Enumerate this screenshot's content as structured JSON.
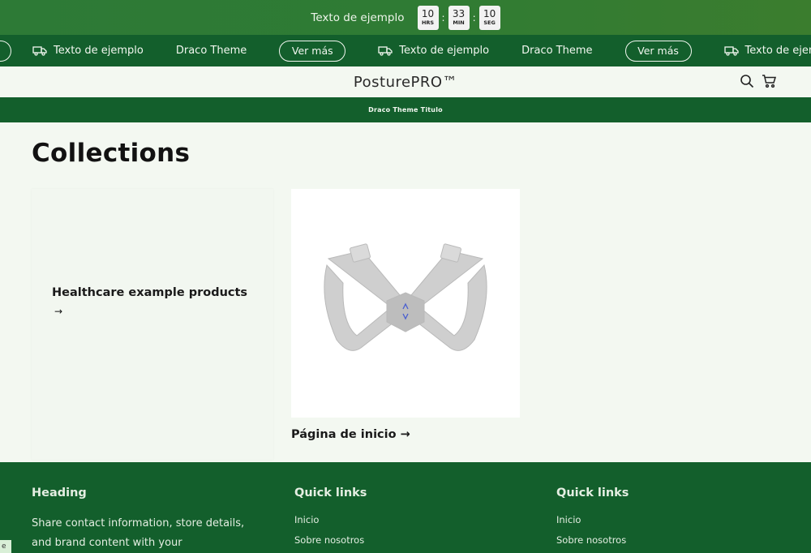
{
  "topbar": {
    "promo_text": "Texto de ejemplo",
    "countdown": [
      {
        "value": "10",
        "unit": "HRS"
      },
      {
        "value": "33",
        "unit": "MIN"
      },
      {
        "value": "10",
        "unit": "SEG"
      }
    ],
    "separator": ":"
  },
  "marquee": {
    "item_text": "Texto de ejemplo",
    "brand_text": "Draco Theme",
    "button_label": "Ver más"
  },
  "header": {
    "logo": "PosturePRO™"
  },
  "announcement": {
    "text": "Draco Theme Titulo"
  },
  "main": {
    "title": "Collections",
    "collections": [
      {
        "label": "Healthcare example products",
        "arrow": "→"
      },
      {
        "label": "Página de inicio",
        "arrow": "→"
      }
    ]
  },
  "footer": {
    "col1": {
      "heading": "Heading",
      "text": "Share contact information, store details, and brand content with your"
    },
    "col2": {
      "heading": "Quick links",
      "links": [
        "Inicio",
        "Sobre nosotros"
      ]
    },
    "col3": {
      "heading": "Quick links",
      "links": [
        "Inicio",
        "Sobre nosotros"
      ]
    }
  },
  "corner_tab": "e",
  "colors": {
    "primary_green": "#135f2c",
    "top_green": "#2f7b34",
    "page_bg": "#f3f8f1"
  }
}
